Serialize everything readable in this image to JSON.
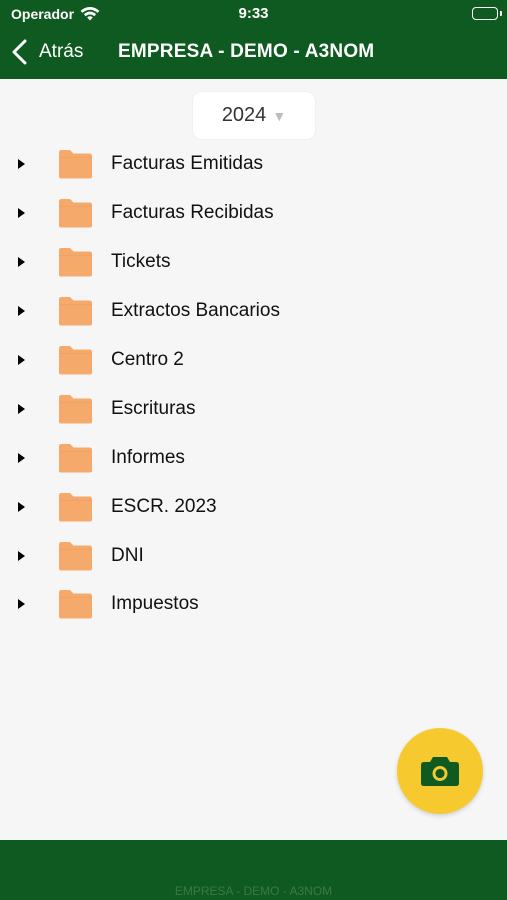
{
  "status_bar": {
    "carrier": "Operador",
    "time": "9:33",
    "battery_level": 1.0
  },
  "nav": {
    "back_label": "Atrás",
    "title": "EMPRESA - DEMO - A3NOM"
  },
  "year_selector": {
    "value": "2024",
    "arrow": "▼"
  },
  "folders": [
    {
      "label": "Facturas Emitidas"
    },
    {
      "label": "Facturas Recibidas"
    },
    {
      "label": "Tickets"
    },
    {
      "label": "Extractos Bancarios"
    },
    {
      "label": "Centro 2"
    },
    {
      "label": "Escrituras"
    },
    {
      "label": "Informes"
    },
    {
      "label": "ESCR. 2023"
    },
    {
      "label": "DNI"
    },
    {
      "label": "Impuestos"
    }
  ],
  "footer": {
    "label": "EMPRESA - DEMO - A3NOM"
  },
  "icons": {
    "wifi": "wifi-icon",
    "battery": "battery-icon",
    "back": "chevron-left-icon",
    "expand": "caret-right-icon",
    "folder": "folder-icon",
    "camera": "camera-icon"
  },
  "colors": {
    "bar": "#0f5a20",
    "folder": "#f5a96a",
    "fab": "#f6c92f",
    "camera": "#0f5a20"
  }
}
